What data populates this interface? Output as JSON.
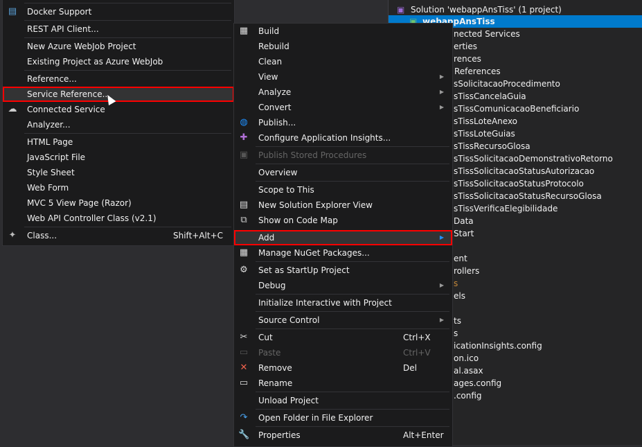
{
  "solution_explorer": {
    "solution_label": "Solution 'webappAnsTiss' (1 project)",
    "project_label": "webappAnsTiss",
    "visible_fragments": [
      "nected Services",
      "erties",
      "rences",
      "References",
      "sSolicitacaoProcedimento",
      "sTissCancelaGuia",
      "sTissComunicacaoBeneficiario",
      "sTissLoteAnexo",
      "sTissLoteGuias",
      "sTissRecursoGlosa",
      "sTissSolicitacaoDemonstrativoRetorno",
      "sTissSolicitacaoStatusAutorizacao",
      "sTissSolicitacaoStatusProtocolo",
      "sTissSolicitacaoStatusRecursoGlosa",
      "sTissVerificaElegibilidade",
      "Data",
      "Start",
      "",
      "ent",
      "rollers",
      "s",
      "els",
      "",
      "ts",
      "s",
      "icationInsights.config",
      "on.ico",
      "al.asax",
      "ages.config",
      ".config"
    ]
  },
  "add_submenu": {
    "items": [
      {
        "separator": true
      },
      {
        "label": "Docker Support",
        "icon": "docker-icon"
      },
      {
        "separator": true
      },
      {
        "label": "REST API Client..."
      },
      {
        "separator": true
      },
      {
        "label": "New Azure WebJob Project"
      },
      {
        "label": "Existing Project as Azure WebJob"
      },
      {
        "separator": true
      },
      {
        "label": "Reference..."
      },
      {
        "label": "Service Reference...",
        "highlighted": true
      },
      {
        "label": "Connected Service",
        "icon": "connected-service-icon"
      },
      {
        "label": "Analyzer..."
      },
      {
        "separator": true
      },
      {
        "label": "HTML Page"
      },
      {
        "label": "JavaScript File"
      },
      {
        "label": "Style Sheet"
      },
      {
        "label": "Web Form"
      },
      {
        "label": "MVC 5 View Page (Razor)"
      },
      {
        "label": "Web API Controller Class (v2.1)"
      },
      {
        "separator": true
      },
      {
        "label": "Class...",
        "shortcut": "Shift+Alt+C",
        "icon": "add-class-icon"
      }
    ]
  },
  "context_menu": {
    "items": [
      {
        "label": "Build",
        "icon": "build-icon"
      },
      {
        "label": "Rebuild"
      },
      {
        "label": "Clean"
      },
      {
        "label": "View",
        "submenu": true
      },
      {
        "label": "Analyze",
        "submenu": true
      },
      {
        "label": "Convert",
        "submenu": true
      },
      {
        "label": "Publish...",
        "icon": "publish-globe-icon"
      },
      {
        "label": "Configure Application Insights...",
        "icon": "app-insights-icon"
      },
      {
        "separator": true
      },
      {
        "label": "Publish Stored Procedures",
        "disabled": true,
        "icon": "stored-procedures-icon"
      },
      {
        "separator": true
      },
      {
        "label": "Overview"
      },
      {
        "separator": true
      },
      {
        "label": "Scope to This"
      },
      {
        "label": "New Solution Explorer View",
        "icon": "new-view-icon"
      },
      {
        "label": "Show on Code Map",
        "icon": "code-map-icon"
      },
      {
        "spacer": true
      },
      {
        "label": "Add",
        "submenu": true,
        "highlighted": true
      },
      {
        "label": "Manage NuGet Packages...",
        "icon": "nuget-icon"
      },
      {
        "separator": true
      },
      {
        "label": "Set as StartUp Project",
        "icon": "gear-icon"
      },
      {
        "label": "Debug",
        "submenu": true
      },
      {
        "separator": true
      },
      {
        "label": "Initialize Interactive with Project"
      },
      {
        "separator": true
      },
      {
        "label": "Source Control",
        "submenu": true
      },
      {
        "separator": true
      },
      {
        "label": "Cut",
        "shortcut": "Ctrl+X",
        "icon": "cut-icon"
      },
      {
        "label": "Paste",
        "shortcut": "Ctrl+V",
        "disabled": true,
        "icon": "paste-icon"
      },
      {
        "label": "Remove",
        "shortcut": "Del",
        "icon": "remove-icon"
      },
      {
        "label": "Rename",
        "icon": "rename-icon"
      },
      {
        "separator": true
      },
      {
        "label": "Unload Project"
      },
      {
        "separator": true
      },
      {
        "label": "Open Folder in File Explorer",
        "icon": "open-folder-icon"
      },
      {
        "separator": true
      },
      {
        "label": "Properties",
        "shortcut": "Alt+Enter",
        "icon": "wrench-icon"
      }
    ]
  },
  "colors": {
    "accent": "#007acc",
    "highlight_border": "#ff0000",
    "menu_bg": "#1b1b1c",
    "disabled": "#656565"
  }
}
